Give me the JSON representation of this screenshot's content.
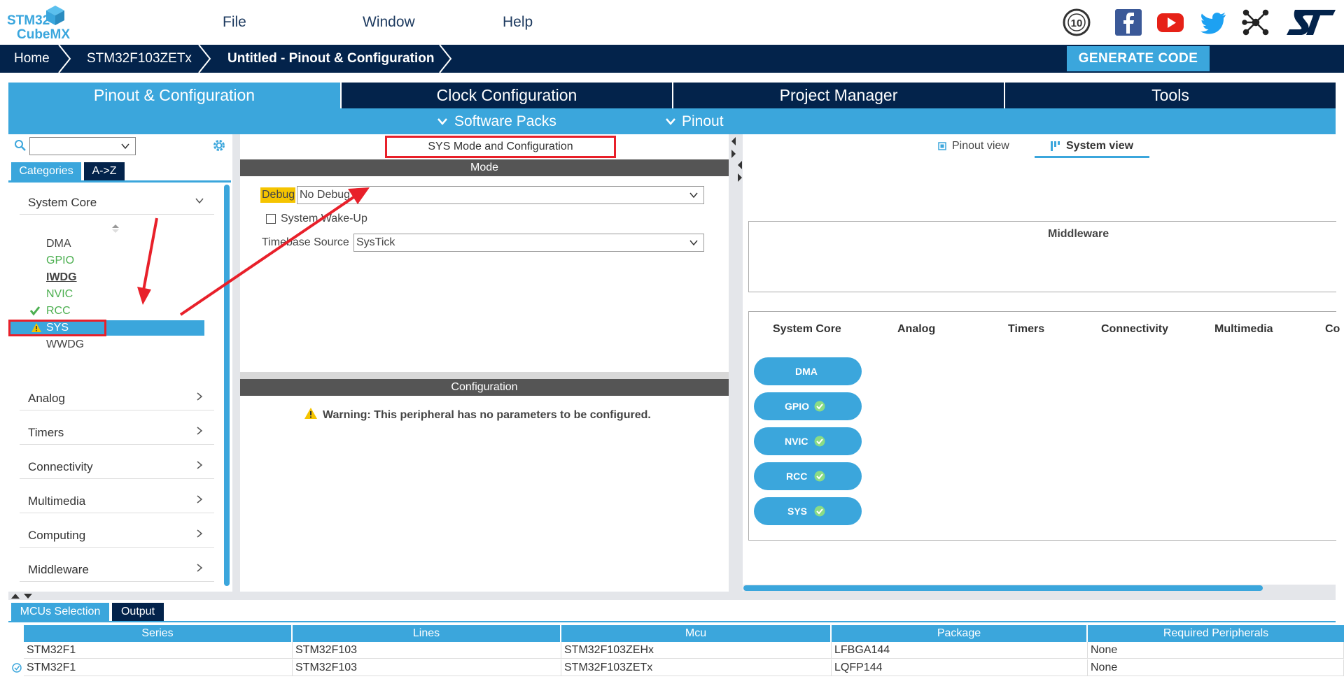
{
  "app": {
    "logo_line1": "STM32",
    "logo_line2": "CubeMX"
  },
  "menu": {
    "file": "File",
    "window": "Window",
    "help": "Help"
  },
  "social": {
    "anniversary": "10",
    "brand": "ST"
  },
  "breadcrumb": {
    "home": "Home",
    "mcu": "STM32F103ZETx",
    "current": "Untitled - Pinout & Configuration"
  },
  "generate_label": "GENERATE CODE",
  "main_tabs": [
    "Pinout & Configuration",
    "Clock Configuration",
    "Project Manager",
    "Tools"
  ],
  "sub_tabs": {
    "software_packs": "Software Packs",
    "pinout": "Pinout"
  },
  "left": {
    "category_tabs": [
      "Categories",
      "A->Z"
    ],
    "system_core": "System Core",
    "peripherals": [
      {
        "name": "DMA",
        "state": "normal"
      },
      {
        "name": "GPIO",
        "state": "green"
      },
      {
        "name": "IWDG",
        "state": "bold"
      },
      {
        "name": "NVIC",
        "state": "green"
      },
      {
        "name": "RCC",
        "state": "checked"
      },
      {
        "name": "SYS",
        "state": "warning"
      },
      {
        "name": "WWDG",
        "state": "normal"
      }
    ],
    "groups": [
      "Analog",
      "Timers",
      "Connectivity",
      "Multimedia",
      "Computing",
      "Middleware"
    ]
  },
  "middle": {
    "title": "SYS Mode and Configuration",
    "mode_header": "Mode",
    "debug_label": "Debug",
    "debug_value": "No Debug",
    "wakeup_label": "System Wake-Up",
    "timebase_label": "Timebase Source",
    "timebase_value": "SysTick",
    "config_header": "Configuration",
    "warning_text": "Warning: This peripheral has no parameters to be configured."
  },
  "right": {
    "view_tabs": {
      "pinout": "Pinout view",
      "system": "System view"
    },
    "middleware_title": "Middleware",
    "columns": [
      "System Core",
      "Analog",
      "Timers",
      "Connectivity",
      "Multimedia",
      "Co"
    ],
    "pills": [
      "DMA",
      "GPIO",
      "NVIC",
      "RCC",
      "SYS"
    ]
  },
  "bottom": {
    "tabs": [
      "MCUs Selection",
      "Output"
    ],
    "headers": [
      "Series",
      "Lines",
      "Mcu",
      "Package",
      "Required Peripherals"
    ],
    "rows": [
      [
        "STM32F1",
        "STM32F103",
        "STM32F103ZEHx",
        "LFBGA144",
        "None"
      ],
      [
        "STM32F1",
        "STM32F103",
        "STM32F103ZETx",
        "LQFP144",
        "None"
      ]
    ]
  },
  "colors": {
    "accent": "#3ba6dc",
    "navy": "#03234b",
    "green": "#4caf50",
    "warn": "#f5c400",
    "annotation": "#e8202a"
  }
}
